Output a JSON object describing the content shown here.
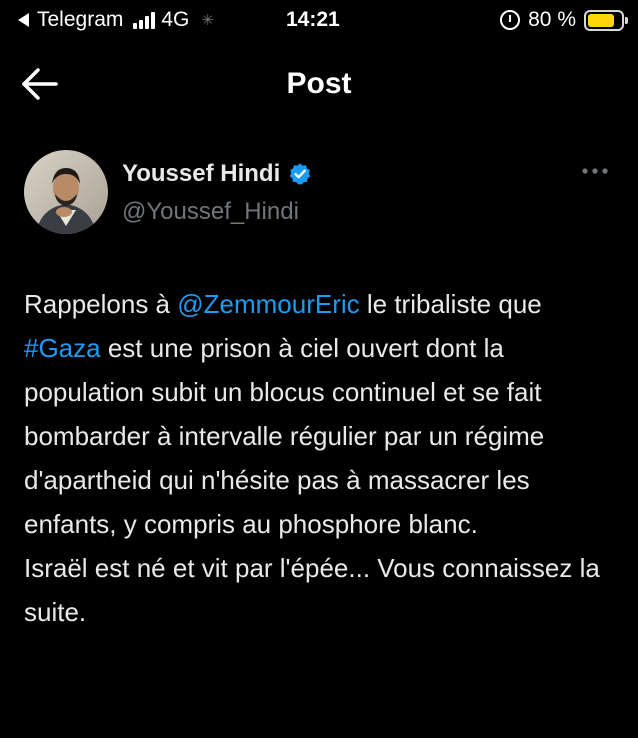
{
  "status_bar": {
    "carrier": "Telegram",
    "network": "4G",
    "time": "14:21",
    "battery": "80 %",
    "battery_level": 0.8,
    "battery_color": "#ffd60a"
  },
  "header": {
    "title": "Post",
    "back_icon": "arrow-left-icon"
  },
  "tweet": {
    "display_name": "Youssef Hindi",
    "handle": "@Youssef_Hindi",
    "verified_color": "#1d9bf0",
    "more_icon": "ellipsis-icon",
    "text": {
      "p1": "Rappelons à ",
      "mention": "@ZemmourEric",
      "p2": " le tribaliste que ",
      "hashtag": "#Gaza",
      "p3": " est une prison à ciel ouvert dont la population subit un blocus continuel et se fait bombarder à intervalle régulier par un régime d'apartheid qui n'hésite pas à massacrer les enfants, y compris au phosphore blanc.",
      "p4": "Israël est né et vit par l'épée... Vous connaissez la suite."
    },
    "link_color": "#1d9bf0"
  }
}
